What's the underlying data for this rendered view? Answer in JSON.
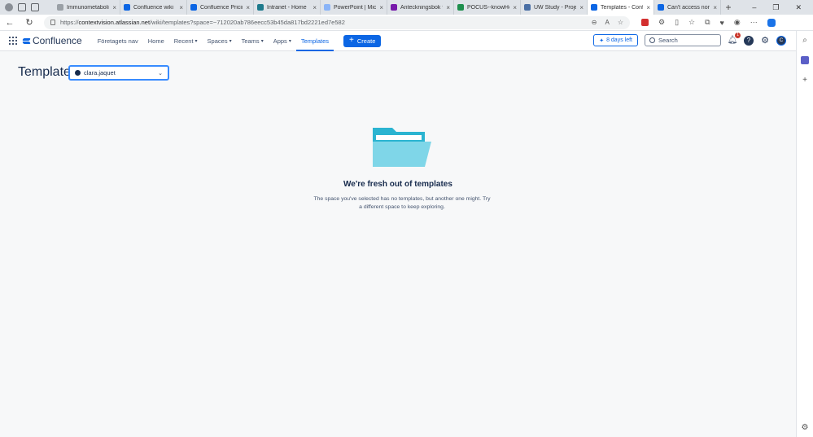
{
  "browser": {
    "tabs": [
      {
        "title": "Immunometabolic",
        "favicon_color": "#9aa0a6"
      },
      {
        "title": "Confluence wiki",
        "favicon_color": "#0c66e4"
      },
      {
        "title": "Confluence Pricing",
        "favicon_color": "#0c66e4"
      },
      {
        "title": "Intranet - Home",
        "favicon_color": "#1e7a8c"
      },
      {
        "title": "PowerPoint | Micr",
        "favicon_color": "#8ab4f8"
      },
      {
        "title": "Anteckningsbok fö",
        "favicon_color": "#7719aa"
      },
      {
        "title": "POCUS--knowHo",
        "favicon_color": "#1f8f4e"
      },
      {
        "title": "UW Study - Proje",
        "favicon_color": "#4a6fa5"
      },
      {
        "title": "Templates - Conf",
        "favicon_color": "#0c66e4"
      },
      {
        "title": "Can't access nor",
        "favicon_color": "#0c66e4"
      }
    ],
    "new_tab": "+",
    "window_controls": [
      "–",
      "❐",
      "✕"
    ],
    "url_prefix": "https://",
    "url_host": "contextvision.atlassian.net",
    "url_path": "/wiki/templates?space=~712020ab786eecc53b45da817bd2221ed7e582"
  },
  "nav": {
    "logo_text": "Confluence",
    "items": [
      {
        "label": "Företagets nav",
        "has_chevron": false
      },
      {
        "label": "Home",
        "has_chevron": false
      },
      {
        "label": "Recent",
        "has_chevron": true
      },
      {
        "label": "Spaces",
        "has_chevron": true
      },
      {
        "label": "Teams",
        "has_chevron": true
      },
      {
        "label": "Apps",
        "has_chevron": true
      },
      {
        "label": "Templates",
        "has_chevron": false,
        "active": true
      }
    ],
    "create_label": "Create",
    "trial_label": "8 days left",
    "search_placeholder": "Search",
    "notification_count": "1",
    "help_symbol": "?",
    "avatar_initial": "C"
  },
  "page": {
    "title": "Templates",
    "space_selector_value": "clara.jaquet"
  },
  "empty_state": {
    "heading": "We're fresh out of templates",
    "description": "The space you've selected has no templates, but another one might. Try a different space to keep exploring."
  },
  "colors": {
    "brand_blue": "#0c66e4",
    "folder_light": "#7fd6e8",
    "folder_dark": "#2bb4d1"
  },
  "icons": [
    "app-switcher-icon",
    "confluence-logo-icon",
    "plus-icon",
    "sparkle-icon",
    "search-icon",
    "bell-icon",
    "help-icon",
    "gear-icon",
    "folder-illustration"
  ]
}
